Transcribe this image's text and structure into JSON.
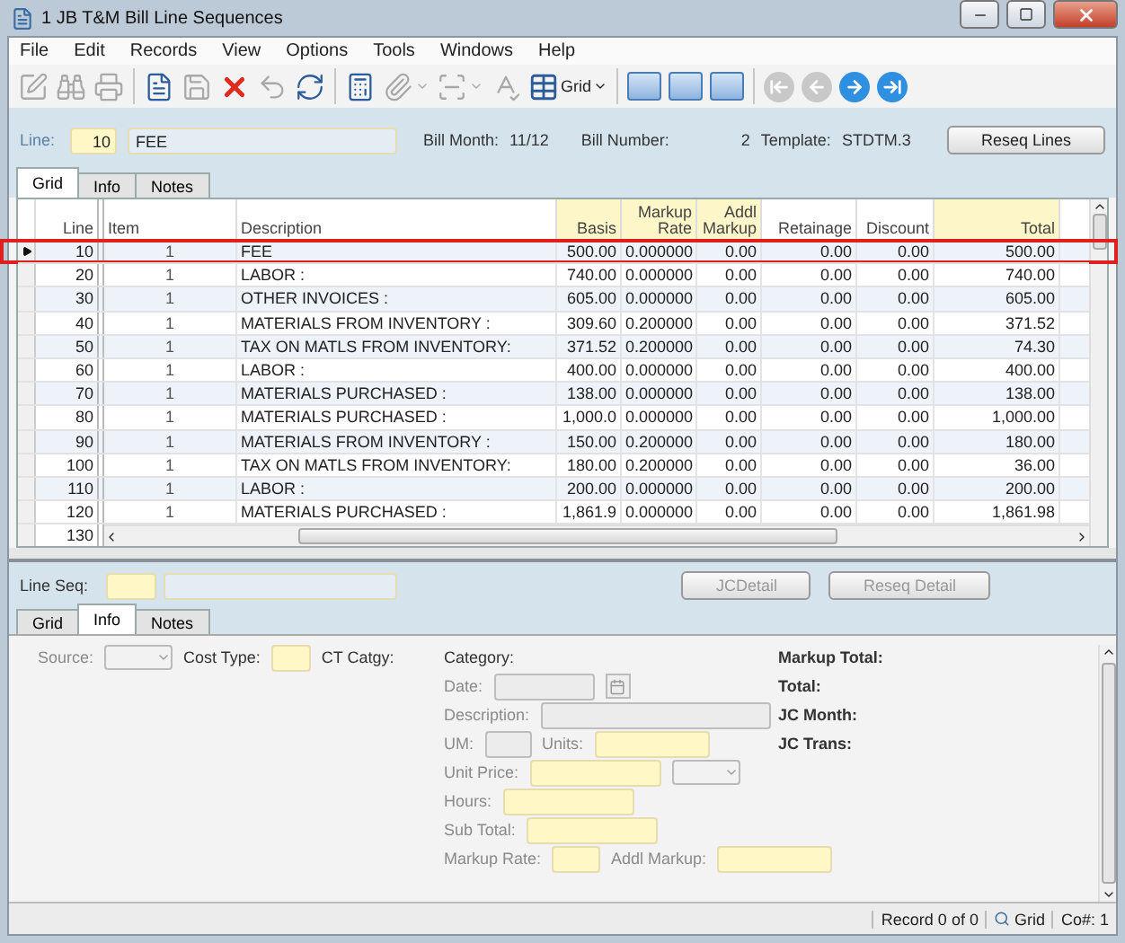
{
  "window": {
    "title": "1 JB T&M Bill Line Sequences"
  },
  "menu": [
    {
      "label": "File"
    },
    {
      "label": "Edit"
    },
    {
      "label": "Records"
    },
    {
      "label": "View"
    },
    {
      "label": "Options"
    },
    {
      "label": "Tools"
    },
    {
      "label": "Windows"
    },
    {
      "label": "Help"
    }
  ],
  "toolbar": {
    "view_label": "Grid",
    "groups": [
      [
        {
          "kind": "edit",
          "disabled": true
        },
        {
          "kind": "find",
          "disabled": true
        },
        {
          "kind": "print",
          "disabled": true
        }
      ],
      [
        {
          "kind": "new",
          "disabled": false
        },
        {
          "kind": "save",
          "disabled": true
        },
        {
          "kind": "delete",
          "disabled": false
        },
        {
          "kind": "undo",
          "disabled": true
        },
        {
          "kind": "refresh",
          "disabled": false
        }
      ],
      [
        {
          "kind": "calc",
          "disabled": false
        },
        {
          "kind": "attach",
          "disabled": true
        },
        {
          "kind": "scan",
          "disabled": true
        },
        {
          "kind": "spell",
          "disabled": true
        },
        {
          "kind": "view",
          "disabled": false
        }
      ],
      [
        {
          "kind": "layout"
        },
        {
          "kind": "layout"
        },
        {
          "kind": "layout"
        }
      ],
      [
        {
          "kind": "first",
          "disabled": true
        },
        {
          "kind": "prev",
          "disabled": true
        },
        {
          "kind": "next",
          "disabled": false
        },
        {
          "kind": "last",
          "disabled": false
        }
      ]
    ]
  },
  "header": {
    "line_label": "Line:",
    "line_value": "10",
    "line_desc": "FEE",
    "bill_month_label": "Bill Month:",
    "bill_month": "11/12",
    "bill_number_label": "Bill Number:",
    "bill_number": "2",
    "template_label": "Template:",
    "template": "STDTM.3",
    "reseq_button": "Reseq Lines"
  },
  "tabs": [
    {
      "label": "Grid",
      "selected": true
    },
    {
      "label": "Info",
      "selected": false
    },
    {
      "label": "Notes",
      "selected": false
    }
  ],
  "grid": {
    "columns": [
      {
        "label": "Line",
        "required": false
      },
      {
        "label": "Item",
        "required": false
      },
      {
        "label": "Description",
        "required": false
      },
      {
        "label": "Basis",
        "required": true
      },
      {
        "label": "Markup Rate",
        "required": true
      },
      {
        "label": "Addl Markup",
        "required": true
      },
      {
        "label": "Retainage",
        "required": false
      },
      {
        "label": "Discount",
        "required": false
      },
      {
        "label": "Total",
        "required": true
      }
    ],
    "rows": [
      {
        "selected": true,
        "outlined": true,
        "cells": [
          "10",
          "1",
          "FEE",
          "500.00",
          "0.000000",
          "0.00",
          "0.00",
          "0.00",
          "500.00"
        ]
      },
      {
        "selected": false,
        "outlined": false,
        "cells": [
          "20",
          "1",
          "LABOR :",
          "740.00",
          "0.000000",
          "0.00",
          "0.00",
          "0.00",
          "740.00"
        ]
      },
      {
        "selected": false,
        "outlined": false,
        "cells": [
          "30",
          "1",
          "OTHER INVOICES :",
          "605.00",
          "0.000000",
          "0.00",
          "0.00",
          "0.00",
          "605.00"
        ]
      },
      {
        "selected": false,
        "outlined": false,
        "cells": [
          "40",
          "1",
          "MATERIALS FROM INVENTORY :",
          "309.60",
          "0.200000",
          "0.00",
          "0.00",
          "0.00",
          "371.52"
        ]
      },
      {
        "selected": false,
        "outlined": false,
        "cells": [
          "50",
          "1",
          "TAX ON MATLS FROM INVENTORY:",
          "371.52",
          "0.200000",
          "0.00",
          "0.00",
          "0.00",
          "74.30"
        ]
      },
      {
        "selected": false,
        "outlined": false,
        "cells": [
          "60",
          "1",
          "LABOR :",
          "400.00",
          "0.000000",
          "0.00",
          "0.00",
          "0.00",
          "400.00"
        ]
      },
      {
        "selected": false,
        "outlined": false,
        "cells": [
          "70",
          "1",
          "MATERIALS PURCHASED :",
          "138.00",
          "0.000000",
          "0.00",
          "0.00",
          "0.00",
          "138.00"
        ]
      },
      {
        "selected": false,
        "outlined": false,
        "cells": [
          "80",
          "1",
          "MATERIALS PURCHASED :",
          "1,000.0",
          "0.000000",
          "0.00",
          "0.00",
          "0.00",
          "1,000.00"
        ]
      },
      {
        "selected": false,
        "outlined": false,
        "cells": [
          "90",
          "1",
          "MATERIALS FROM INVENTORY :",
          "150.00",
          "0.200000",
          "0.00",
          "0.00",
          "0.00",
          "180.00"
        ]
      },
      {
        "selected": false,
        "outlined": false,
        "cells": [
          "100",
          "1",
          "TAX ON MATLS FROM INVENTORY:",
          "180.00",
          "0.200000",
          "0.00",
          "0.00",
          "0.00",
          "36.00"
        ]
      },
      {
        "selected": false,
        "outlined": false,
        "cells": [
          "110",
          "1",
          "LABOR :",
          "200.00",
          "0.000000",
          "0.00",
          "0.00",
          "0.00",
          "200.00"
        ]
      },
      {
        "selected": false,
        "outlined": false,
        "cells": [
          "120",
          "1",
          "MATERIALS PURCHASED :",
          "1,861.9",
          "0.000000",
          "0.00",
          "0.00",
          "0.00",
          "1,861.98"
        ]
      },
      {
        "selected": false,
        "outlined": false,
        "cells": [
          "130"
        ]
      }
    ]
  },
  "detail": {
    "line_seq_label": "Line Seq:",
    "buttons": [
      {
        "label": "JCDetail",
        "disabled": true
      },
      {
        "label": "Reseq Detail",
        "disabled": true
      }
    ],
    "tabs": [
      {
        "label": "Grid",
        "selected": false
      },
      {
        "label": "Info",
        "selected": true
      },
      {
        "label": "Notes",
        "selected": false
      }
    ],
    "left": [
      {
        "kind": "label",
        "text": "Source:",
        "disabled": true
      },
      {
        "kind": "combo"
      },
      {
        "kind": "label",
        "text": "Cost Type:",
        "disabled": false
      },
      {
        "kind": "field",
        "disabled": false
      },
      {
        "kind": "label",
        "text": "CT Catgy:",
        "disabled": false
      }
    ],
    "middle": [
      [
        {
          "kind": "label",
          "text": "Category:",
          "disabled": false
        }
      ],
      [
        {
          "kind": "label",
          "text": "Date:",
          "disabled": true
        },
        {
          "kind": "field",
          "disabled": true
        },
        {
          "kind": "calendar"
        }
      ],
      [
        {
          "kind": "label",
          "text": "Description:",
          "disabled": true
        },
        {
          "kind": "field",
          "disabled": true
        }
      ],
      [
        {
          "kind": "label",
          "text": "UM:",
          "disabled": true
        },
        {
          "kind": "field",
          "disabled": true
        },
        {
          "kind": "label",
          "text": "Units:",
          "disabled": true
        },
        {
          "kind": "field",
          "disabled": false
        }
      ],
      [
        {
          "kind": "label",
          "text": "Unit Price:",
          "disabled": true
        },
        {
          "kind": "field",
          "disabled": false
        },
        {
          "kind": "combo"
        }
      ],
      [
        {
          "kind": "label",
          "text": "Hours:",
          "disabled": true
        },
        {
          "kind": "field",
          "disabled": false
        }
      ],
      [
        {
          "kind": "label",
          "text": "Sub Total:",
          "disabled": true
        },
        {
          "kind": "field",
          "disabled": false
        }
      ],
      [
        {
          "kind": "label",
          "text": "Markup Rate:",
          "disabled": true
        },
        {
          "kind": "field",
          "disabled": false
        },
        {
          "kind": "label",
          "text": "Addl Markup:",
          "disabled": true
        },
        {
          "kind": "field",
          "disabled": false
        }
      ]
    ],
    "right": [
      {
        "text": "Markup Total:"
      },
      {
        "text": "Total:"
      },
      {
        "text": "JC Month:"
      },
      {
        "text": "JC Trans:"
      }
    ]
  },
  "status_bar": {
    "record": "Record 0 of 0",
    "view": "Grid",
    "company": "Co#: 1"
  }
}
